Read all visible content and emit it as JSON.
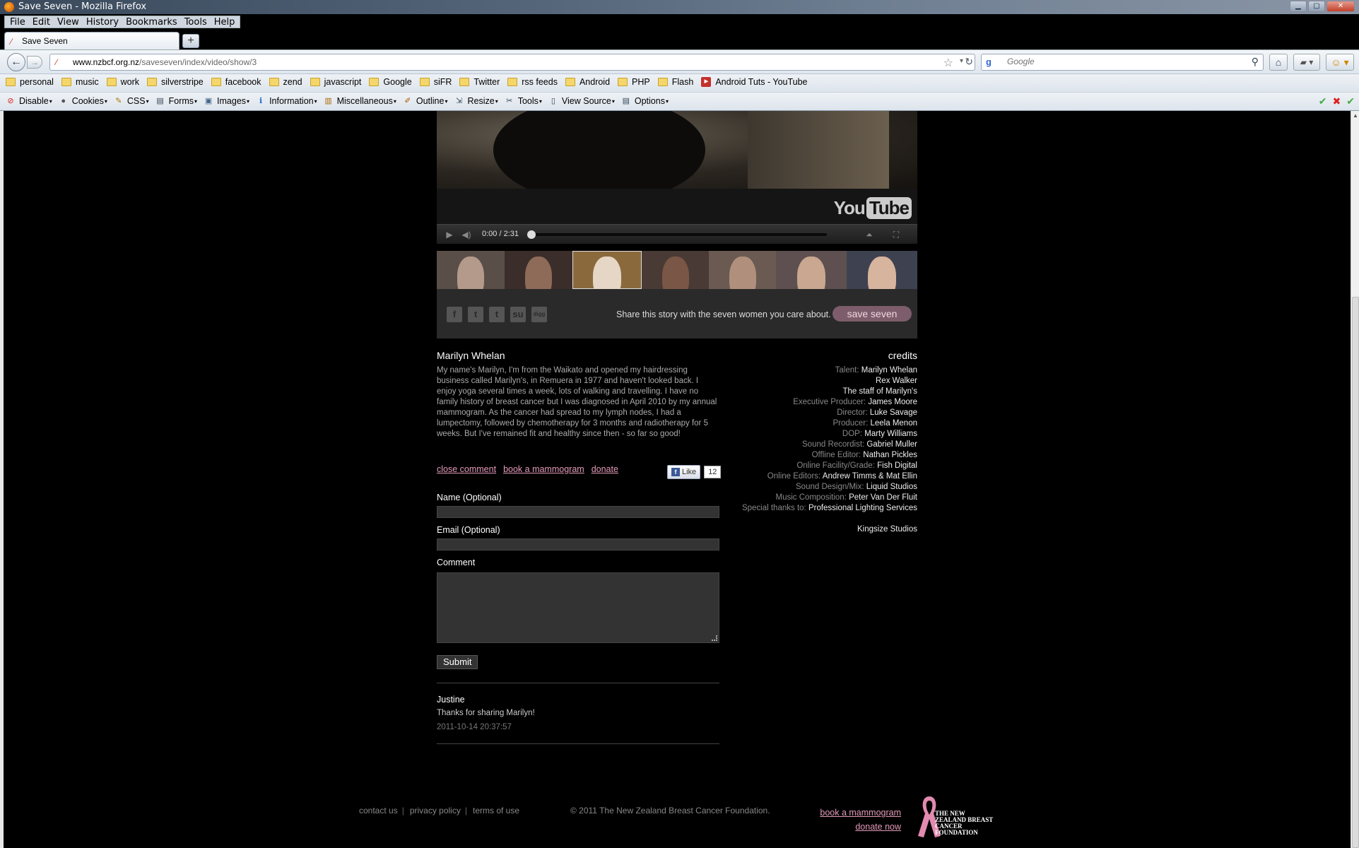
{
  "window": {
    "title": "Save Seven - Mozilla Firefox",
    "menu": [
      "File",
      "Edit",
      "View",
      "History",
      "Bookmarks",
      "Tools",
      "Help"
    ],
    "tab_label": "Save Seven",
    "new_tab_symbol": "+",
    "url_domain": "www.nzbcf.org.nz",
    "url_path": "/saveseven/index/video/show/3",
    "search_placeholder": "Google",
    "bookmarks": [
      "personal",
      "music",
      "work",
      "silverstripe",
      "facebook",
      "zend",
      "javascript",
      "Google",
      "siFR",
      "Twitter",
      "rss feeds",
      "Android",
      "PHP",
      "Flash"
    ],
    "bookmark_youtube": "Android Tuts - YouTube",
    "devbar": [
      {
        "label": "Disable",
        "icon": "disable-icon"
      },
      {
        "label": "Cookies",
        "icon": "cookies-icon"
      },
      {
        "label": "CSS",
        "icon": "css-icon"
      },
      {
        "label": "Forms",
        "icon": "forms-icon"
      },
      {
        "label": "Images",
        "icon": "images-icon"
      },
      {
        "label": "Information",
        "icon": "information-icon"
      },
      {
        "label": "Miscellaneous",
        "icon": "miscellaneous-icon"
      },
      {
        "label": "Outline",
        "icon": "outline-icon"
      },
      {
        "label": "Resize",
        "icon": "resize-icon"
      },
      {
        "label": "Tools",
        "icon": "tools-icon"
      },
      {
        "label": "View Source",
        "icon": "view-source-icon"
      },
      {
        "label": "Options",
        "icon": "options-icon"
      }
    ]
  },
  "player": {
    "youtube_you": "You",
    "youtube_tube": "Tube",
    "time": "0:00 / 2:31",
    "progress": 0
  },
  "share": {
    "social_icons": [
      "facebook-icon",
      "twitter-icon",
      "tumblr-icon",
      "stumbleupon-icon",
      "digg-icon"
    ],
    "message": "Share this story with the seven women you care about.",
    "button": "save seven"
  },
  "story": {
    "name": "Marilyn Whelan",
    "bio": "My name's Marilyn, I'm from the Waikato and opened my hairdressing business called Marilyn's, in Remuera in 1977 and haven't looked back. I enjoy yoga several times a week, lots of walking and travelling. I have no family history of breast cancer but I was diagnosed in April 2010 by my annual mammogram. As the cancer had spread to my lymph nodes, I had a lumpectomy, followed by chemotherapy for 3 months and radiotherapy for 5 weeks. But I've remained fit and healthy since then - so far so good!",
    "actions": [
      "close comment",
      "book a mammogram",
      "donate"
    ],
    "fb_like": "Like",
    "fb_count": "12"
  },
  "form": {
    "name_label": "Name (Optional)",
    "email_label": "Email (Optional)",
    "comment_label": "Comment",
    "submit": "Submit"
  },
  "comments": [
    {
      "author": "Justine",
      "body": "Thanks for sharing Marilyn!",
      "date": "2011-10-14 20:37:57"
    }
  ],
  "credits": {
    "title": "credits",
    "rows": [
      {
        "k": "Talent:",
        "v": "Marilyn Whelan"
      },
      {
        "k": "",
        "v": "Rex Walker"
      },
      {
        "k": "",
        "v": "The staff of Marilyn's"
      },
      {
        "k": "Executive Producer:",
        "v": "James Moore"
      },
      {
        "k": "Director:",
        "v": "Luke Savage"
      },
      {
        "k": "Producer:",
        "v": "Leela Menon"
      },
      {
        "k": "DOP:",
        "v": "Marty Williams"
      },
      {
        "k": "Sound Recordist:",
        "v": "Gabriel Muller"
      },
      {
        "k": "Offline Editor:",
        "v": "Nathan Pickles"
      },
      {
        "k": "Online Facility/Grade:",
        "v": "Fish Digital"
      },
      {
        "k": "Online Editors:",
        "v": "Andrew Timms & Mat Ellin"
      },
      {
        "k": "Sound Design/Mix:",
        "v": "Liquid Studios"
      },
      {
        "k": "Music Composition:",
        "v": "Peter Van Der Fluit"
      },
      {
        "k": "Special thanks to:",
        "v": "Professional Lighting Services"
      }
    ],
    "footer": "Kingsize Studios"
  },
  "footer": {
    "links": [
      "contact us",
      "privacy policy",
      "terms of use"
    ],
    "copyright": "© 2011 The New Zealand Breast Cancer Foundation.",
    "cta": [
      "book a mammogram",
      "donate now"
    ],
    "org": "THE NEW ZEALAND BREAST CANCER FOUNDATION"
  },
  "colors": {
    "accent_pink": "#e49ab9",
    "save_button": "#7d5d6b",
    "background": "#000000"
  }
}
